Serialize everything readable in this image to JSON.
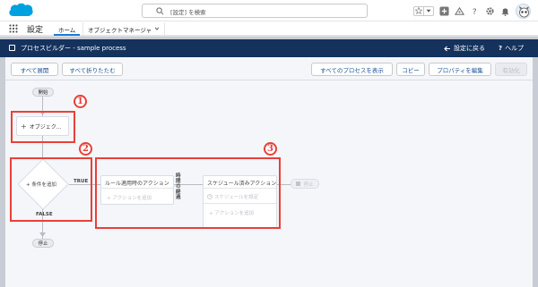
{
  "header": {
    "search_placeholder": "[設定] を検索"
  },
  "nav": {
    "app_name": "設定",
    "tabs": [
      {
        "label": "ホーム"
      },
      {
        "label": "オブジェクトマネージャ"
      }
    ]
  },
  "builder": {
    "title": "プロセスビルダー - sample process",
    "back_label": "設定に戻る",
    "help_label": "ヘルプ"
  },
  "toolbar": {
    "expand_all": "すべて展開",
    "collapse_all": "すべて折りたたむ",
    "show_all_processes": "すべてのプロセスを表示",
    "copy": "コピー",
    "edit_properties": "プロパティを編集",
    "activate": "有効化"
  },
  "canvas": {
    "start_label": "開始",
    "object_label": "オブジェク...",
    "add_criteria_label": "条件を追加",
    "true_label": "TRUE",
    "false_label": "FALSE",
    "stop_label": "停止",
    "stop_label_right": "停止",
    "immediate_actions_title": "ルール適用時のアクション",
    "add_action_label": "アクションを追加",
    "time_passes_label": "時間の経過",
    "scheduled_actions_title": "スケジュール済みアクション",
    "set_schedule_label": "スケジュールを設定",
    "add_action_label_2": "アクションを追加",
    "badges": [
      "1",
      "2",
      "3"
    ]
  },
  "colors": {
    "brand_blue": "#00a1e0",
    "header_navy": "#14325c",
    "annotation_red": "#e8403a",
    "link_blue": "#1b5297"
  }
}
